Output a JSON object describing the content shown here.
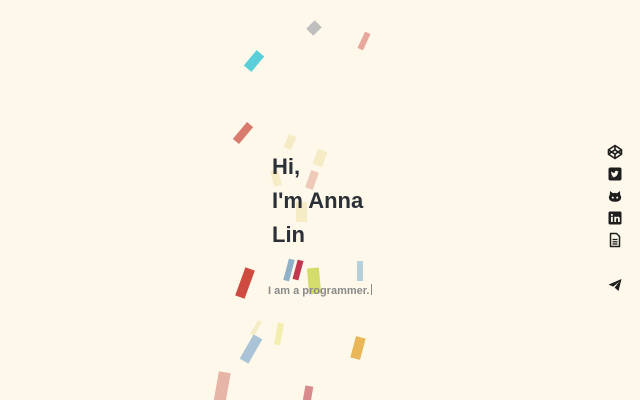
{
  "hero": {
    "greeting_line1": "Hi,",
    "greeting_line2": "I'm Anna",
    "greeting_line3": "Lin",
    "tagline": "I am a programmer."
  },
  "social_links": [
    {
      "icon": "codepen-icon"
    },
    {
      "icon": "twitter-icon"
    },
    {
      "icon": "github-icon"
    },
    {
      "icon": "linkedin-icon"
    },
    {
      "icon": "resume-document-icon"
    }
  ],
  "contact": {
    "icon": "send-paper-plane-icon"
  },
  "colors": {
    "background": "#fdf8e9",
    "heading": "#2b2f36",
    "tagline": "#8a8a8a",
    "icon": "#1e1e1e",
    "confetti": [
      "#5bcfd9",
      "#bfbfbf",
      "#e8a79c",
      "#d97b6c",
      "#f5ecc6",
      "#efc8b8",
      "#8fb0c9",
      "#c2374f",
      "#d4dc6c",
      "#b6cfd9",
      "#cf4a3f",
      "#aac3d6",
      "#f3eeae",
      "#e9b758",
      "#e6b5a8",
      "#d98a8a"
    ]
  }
}
